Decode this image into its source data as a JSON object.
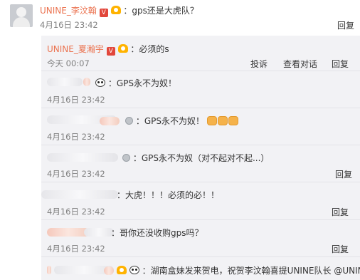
{
  "top_comment": {
    "username": "UNINE_李汶翰",
    "verified_badge": "V",
    "text": "：gps还是大虎队？",
    "timestamp": "4月16日 23:42",
    "reply_label": "回复"
  },
  "replies": [
    {
      "username": "UNINE_夏瀚宇",
      "verified_badge": "V",
      "text": "：必须的s",
      "timestamp": "今天 00:07",
      "actions": [
        "投诉",
        "查看对话",
        "回复"
      ]
    },
    {
      "text": "：GPS永不为奴！",
      "timestamp": "4月16日 23:42",
      "icon": "panda-icon"
    },
    {
      "text": "：GPS永不为奴！",
      "timestamp": "4月16日 23:42",
      "icon": "silver-badge-icon",
      "emoji": [
        "fist-emoji",
        "fist-emoji",
        "fist-emoji"
      ]
    },
    {
      "text": "：GPS永不为奴（对不起对不起...）",
      "timestamp": "4月16日 23:42",
      "reply_label": "回复",
      "icon": "silver-badge-icon"
    },
    {
      "text": "：大虎！！！必须的必！！",
      "timestamp": "4月16日 23:42",
      "reply_label": "回复"
    },
    {
      "text": "：哥你还没收购gps吗？",
      "timestamp": "4月16日 23:42",
      "reply_label": "回复"
    },
    {
      "text": "：湖南盒妹发来贺电，祝贺李汶翰喜提UNINE队长 @UNIN",
      "icon": "panda-icon"
    }
  ],
  "colors": {
    "username": "#eb7350",
    "panel_bg": "#f2f2f5",
    "timestamp": "#808080"
  }
}
